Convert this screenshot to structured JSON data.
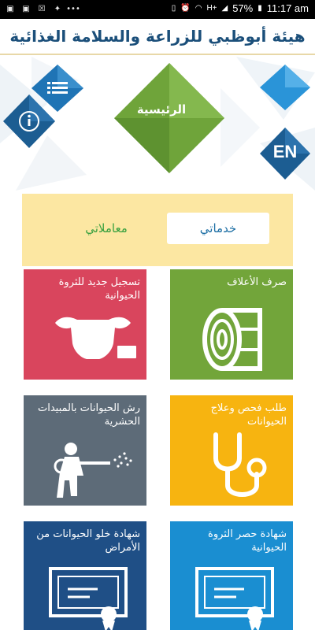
{
  "status_bar": {
    "battery": "57%",
    "time": "11:17 am",
    "network": "H+",
    "icons": [
      "gallery-icon",
      "gallery-icon",
      "close-box-icon",
      "ribbon-icon",
      "more-dots-icon",
      "vibrate-icon",
      "alarm-icon",
      "wifi-icon",
      "signal-icon",
      "battery-icon"
    ]
  },
  "header": {
    "title": "هيئة أبوظبي للزراعة والسلامة الغذائية"
  },
  "nav": {
    "home_label": "الرئيسية",
    "language_label": "EN"
  },
  "tabs": {
    "services": "خدماتي",
    "transactions": "معاملاتي"
  },
  "tiles": [
    {
      "label": "تسجيل جديد للثروة الحيوانية",
      "icon": "livestock-registration-icon",
      "color": "#d9455d"
    },
    {
      "label": "صرف الأعلاف",
      "icon": "hay-bale-icon",
      "color": "#72a53a"
    },
    {
      "label": "رش الحيوانات بالمبيدات الحشرية",
      "icon": "sprayer-icon",
      "color": "#5d6b78"
    },
    {
      "label": "طلب فحص وعلاج الحيوانات",
      "icon": "stethoscope-icon",
      "color": "#f7b410"
    },
    {
      "label": "شهادة خلو الحيوانات من الأمراض",
      "icon": "certificate-icon",
      "color": "#1f4f86"
    },
    {
      "label": "شهادة حصر الثروة الحيوانية",
      "icon": "certificate-icon",
      "color": "#1a8ed1"
    }
  ]
}
